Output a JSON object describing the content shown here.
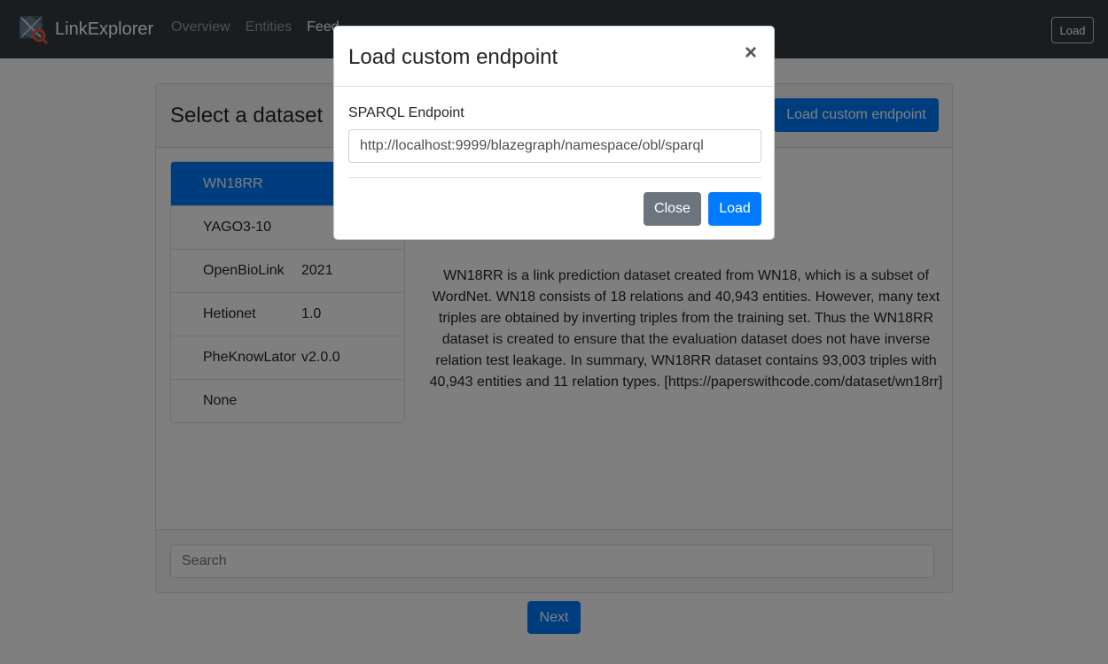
{
  "navbar": {
    "brand_name": "LinkExplorer",
    "brand_icon": "link-explorer-logo-icon",
    "links": [
      {
        "label": "Overview",
        "active": false
      },
      {
        "label": "Entities",
        "active": false
      },
      {
        "label": "Feed",
        "active": true
      }
    ],
    "load_label": "Load"
  },
  "card": {
    "title": "Select a dataset",
    "custom_endpoint_label": "Load custom endpoint",
    "datasets": [
      {
        "name": "WN18RR",
        "version": "",
        "active": true
      },
      {
        "name": "YAGO3-10",
        "version": "",
        "active": false
      },
      {
        "name": "OpenBioLink",
        "version": "2021",
        "active": false
      },
      {
        "name": "Hetionet",
        "version": "1.0",
        "active": false
      },
      {
        "name": "PheKnowLator",
        "version": "v2.0.0",
        "active": false
      },
      {
        "name": "None",
        "version": "",
        "active": false
      }
    ],
    "description": "WN18RR is a link prediction dataset created from WN18, which is a subset of WordNet. WN18 consists of 18 relations and 40,943 entities. However, many text triples are obtained by inverting triples from the training set. Thus the WN18RR dataset is created to ensure that the evaluation dataset does not have inverse relation test leakage. In summary, WN18RR dataset contains 93,003 triples with 40,943 entities and 11 relation types. [https://paperswithcode.com/dataset/wn18rr]",
    "search_placeholder": "Search"
  },
  "next_label": "Next",
  "modal": {
    "title": "Load custom endpoint",
    "close_icon": "close-icon",
    "close_symbol": "×",
    "field_label": "SPARQL Endpoint",
    "field_value": "http://localhost:9999/blazegraph/namespace/obl/sparql",
    "close_label": "Close",
    "load_label": "Load"
  },
  "colors": {
    "primary": "#007bff",
    "secondary": "#6c757d",
    "navbar": "#343a40"
  }
}
